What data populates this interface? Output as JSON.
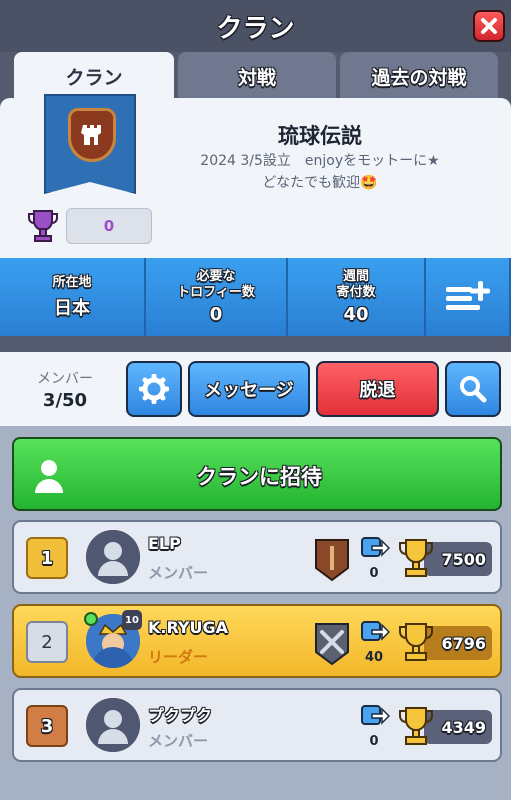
{
  "header": {
    "title": "クラン"
  },
  "tabs": [
    {
      "label": "クラン",
      "active": true
    },
    {
      "label": "対戦",
      "active": false
    },
    {
      "label": "過去の対戦",
      "active": false
    }
  ],
  "clan": {
    "name": "琉球伝説",
    "description": "2024 3/5設立　enjoyをモットーに★\nどなたでも歓迎🤩",
    "trophies": "0",
    "badge_icon": "tower-badge-icon"
  },
  "stats": [
    {
      "label": "所在地",
      "value": "日本"
    },
    {
      "label": "必要な\nトロフィー数",
      "value": "0"
    },
    {
      "label": "週間\n寄付数",
      "value": "40"
    }
  ],
  "actions": {
    "member_label": "メンバー",
    "member_count": "3/50",
    "message_label": "メッセージ",
    "leave_label": "脱退"
  },
  "invite": {
    "label": "クランに招待"
  },
  "members": [
    {
      "rank": "1",
      "name": "ELP",
      "role": "メンバー",
      "donations": "0",
      "trophies": "7500",
      "arena_icon": "wooden-arena-icon"
    },
    {
      "rank": "2",
      "name": "K.RYUGA",
      "role": "リーダー",
      "level": "10",
      "donations": "40",
      "trophies": "6796",
      "arena_icon": "crossed-swords-arena-icon"
    },
    {
      "rank": "3",
      "name": "プクプク",
      "role": "メンバー",
      "donations": "0",
      "trophies": "4349"
    }
  ],
  "colors": {
    "blue_accent": "#2f86e0",
    "green_invite": "#24b431",
    "red_leave": "#e2303a",
    "gold_self": "#f2b72a"
  }
}
